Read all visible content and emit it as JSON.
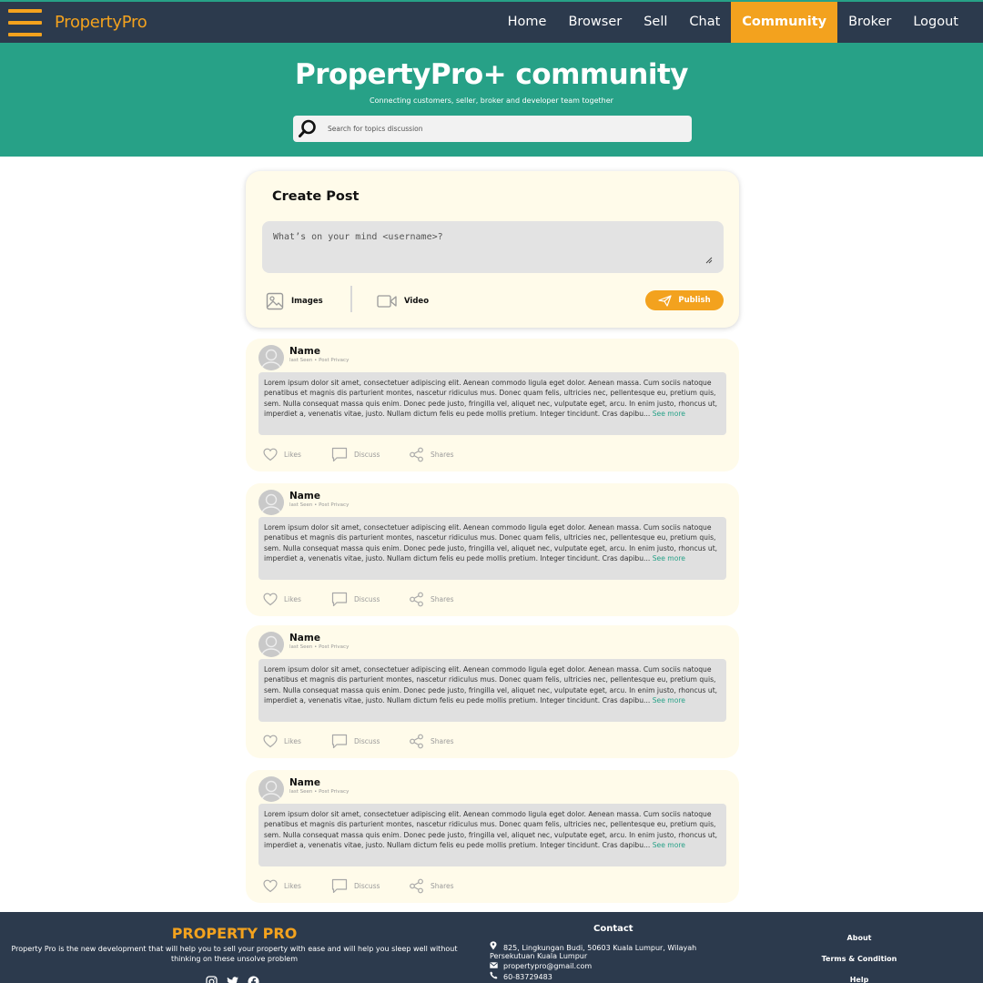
{
  "nav": {
    "brand": "PropertyPro",
    "links": [
      "Home",
      "Browser",
      "Sell",
      "Chat",
      "Community",
      "Broker",
      "Logout"
    ],
    "active": "Community"
  },
  "hero": {
    "title": "PropertyPro+ community",
    "subtitle": "Connecting customers, seller, broker and developer team together",
    "search_placeholder": "Search for topics discussion"
  },
  "create_post": {
    "title": "Create Post",
    "placeholder": "What’s on your mind <username>?",
    "images_label": "Images",
    "video_label": "Video",
    "publish_label": "Publish"
  },
  "posts": [
    {
      "name": "Name",
      "meta": "last Seen • Post Privacy",
      "body": "Lorem ipsum dolor sit amet, consectetuer adipiscing elit. Aenean commodo ligula eget dolor. Aenean massa. Cum sociis natoque penatibus et magnis dis parturient montes, nascetur ridiculus mus. Donec quam felis, ultricies nec, pellentesque eu, pretium quis, sem. Nulla consequat massa quis enim. Donec pede justo, fringilla vel, aliquet nec, vulputate eget, arcu. In enim justo, rhoncus ut, imperdiet a, venenatis vitae, justo. Nullam dictum felis eu pede mollis pretium. Integer tincidunt. Cras dapibu...",
      "see_more": "See more",
      "likes": "Likes",
      "discuss": "Discuss",
      "shares": "Shares"
    },
    {
      "name": "Name",
      "meta": "last Seen • Post Privacy",
      "body": "Lorem ipsum dolor sit amet, consectetuer adipiscing elit. Aenean commodo ligula eget dolor. Aenean massa. Cum sociis natoque penatibus et magnis dis parturient montes, nascetur ridiculus mus. Donec quam felis, ultricies nec, pellentesque eu, pretium quis, sem. Nulla consequat massa quis enim. Donec pede justo, fringilla vel, aliquet nec, vulputate eget, arcu. In enim justo, rhoncus ut, imperdiet a, venenatis vitae, justo. Nullam dictum felis eu pede mollis pretium. Integer tincidunt. Cras dapibu...",
      "see_more": "See more",
      "likes": "Likes",
      "discuss": "Discuss",
      "shares": "Shares"
    },
    {
      "name": "Name",
      "meta": "last Seen • Post Privacy",
      "body": "Lorem ipsum dolor sit amet, consectetuer adipiscing elit. Aenean commodo ligula eget dolor. Aenean massa. Cum sociis natoque penatibus et magnis dis parturient montes, nascetur ridiculus mus. Donec quam felis, ultricies nec, pellentesque eu, pretium quis, sem. Nulla consequat massa quis enim. Donec pede justo, fringilla vel, aliquet nec, vulputate eget, arcu. In enim justo, rhoncus ut, imperdiet a, venenatis vitae, justo. Nullam dictum felis eu pede mollis pretium. Integer tincidunt. Cras dapibu...",
      "see_more": "See more",
      "likes": "Likes",
      "discuss": "Discuss",
      "shares": "Shares"
    },
    {
      "name": "Name",
      "meta": "last Seen • Post Privacy",
      "body": "Lorem ipsum dolor sit amet, consectetuer adipiscing elit. Aenean commodo ligula eget dolor. Aenean massa. Cum sociis natoque penatibus et magnis dis parturient montes, nascetur ridiculus mus. Donec quam felis, ultricies nec, pellentesque eu, pretium quis, sem. Nulla consequat massa quis enim. Donec pede justo, fringilla vel, aliquet nec, vulputate eget, arcu. In enim justo, rhoncus ut, imperdiet a, venenatis vitae, justo. Nullam dictum felis eu pede mollis pretium. Integer tincidunt. Cras dapibu...",
      "see_more": "See more",
      "likes": "Likes",
      "discuss": "Discuss",
      "shares": "Shares"
    }
  ],
  "footer": {
    "brand": "PROPERTY PRO",
    "description": "Property Pro is the new development that will help you to sell your property with ease and will help you sleep well without thinking on these unsolve problem",
    "contact_title": "Contact",
    "address_line1": "825, Lingkungan Budi, 50603 Kuala Lumpur, Wilayah",
    "address_line2": "Persekutuan Kuala Lumpur",
    "email": "propertypro@gmail.com",
    "phone": "60-83729483",
    "links": [
      "About",
      "Terms & Condition",
      "Help"
    ]
  },
  "icons": {
    "menu": "hamburger-icon",
    "search": "search-icon",
    "images": "image-icon",
    "video": "video-icon",
    "publish": "send-icon",
    "likes": "heart-icon",
    "discuss": "comment-icon",
    "shares": "share-icon",
    "avatar": "user-avatar-icon",
    "location": "location-pin-icon",
    "email": "mail-icon",
    "phone": "phone-icon",
    "social": [
      "instagram-icon",
      "twitter-icon",
      "facebook-icon"
    ]
  },
  "colors": {
    "nav_bg": "#2c3a4d",
    "accent": "#f3a21e",
    "hero_bg": "#27a187",
    "card_bg": "#fffbea",
    "post_body_bg": "#e0e0e0"
  }
}
